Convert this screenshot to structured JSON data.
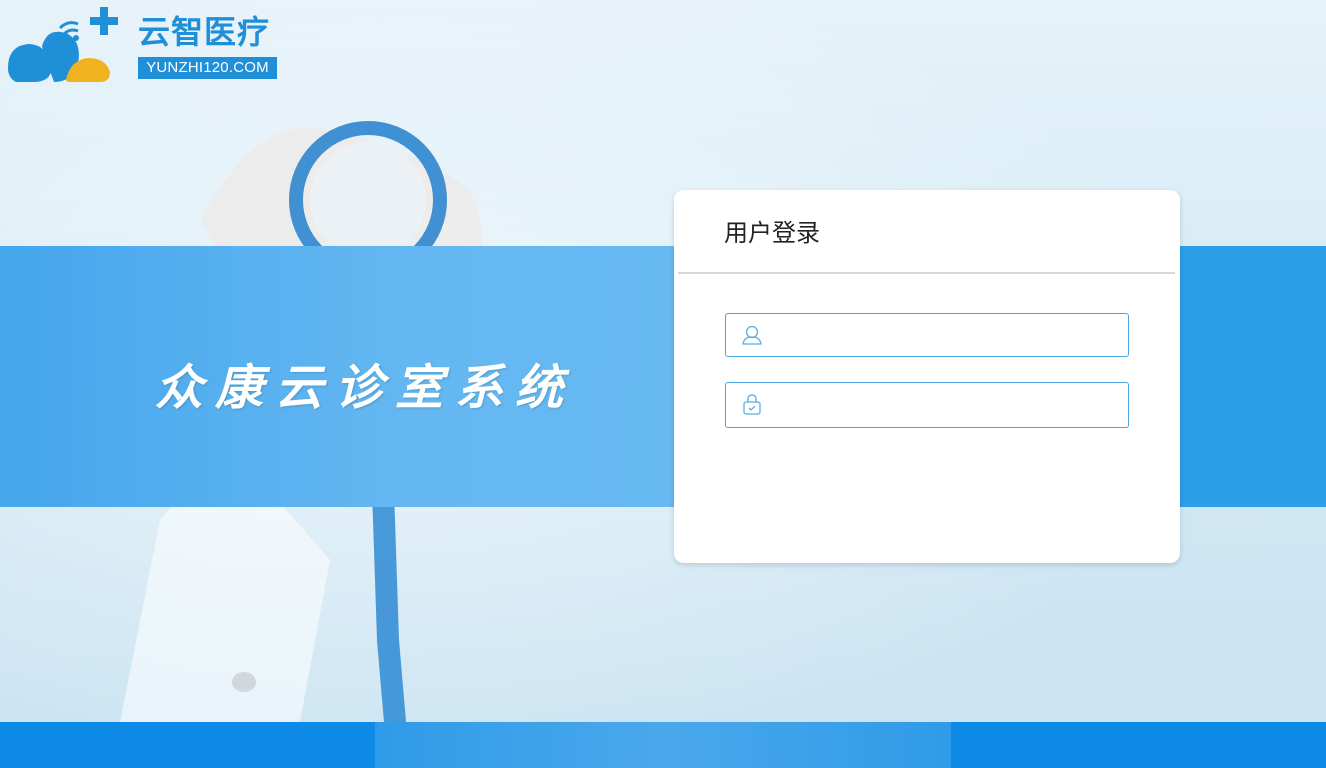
{
  "logo": {
    "title": "云智医疗",
    "url": "YUNZHI120.COM",
    "brand_color": "#1f8fd8",
    "accent_color": "#f0b21f"
  },
  "banner": {
    "system_title": "众康云诊室系统",
    "color": "#2c9ee8"
  },
  "login": {
    "title": "用户登录",
    "username_field": {
      "icon": "user-icon",
      "value": "",
      "placeholder": ""
    },
    "password_field": {
      "icon": "lock-icon",
      "value": "",
      "placeholder": ""
    },
    "border_color": "#4aa6e0"
  },
  "footer": {
    "color": "#0c8ae6"
  }
}
